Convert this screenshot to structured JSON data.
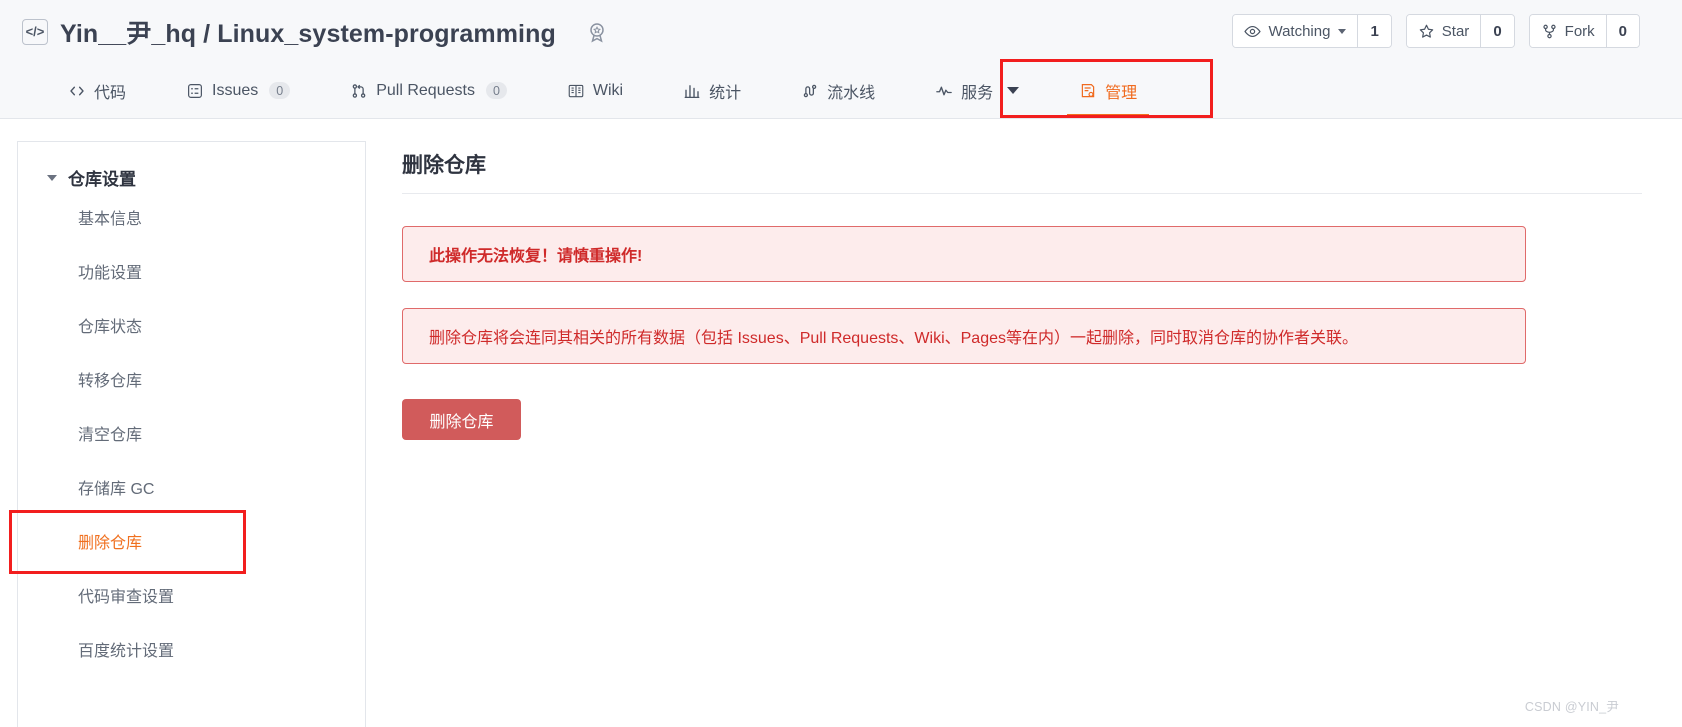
{
  "header": {
    "repo_icon": "code-brackets-icon",
    "owner": "Yin__尹_hq",
    "separator": "/",
    "repo_name": "Linux_system-programming",
    "badge_icon": "award-badge-icon",
    "actions": [
      {
        "icon": "eye-icon",
        "label": "Watching",
        "has_caret": true,
        "count": "1"
      },
      {
        "icon": "star-icon",
        "label": "Star",
        "has_caret": false,
        "count": "0"
      },
      {
        "icon": "fork-icon",
        "label": "Fork",
        "has_caret": false,
        "count": "0"
      }
    ]
  },
  "nav": {
    "tabs": [
      {
        "icon": "code-icon",
        "label": "代码",
        "count": null,
        "active": false,
        "caret": false
      },
      {
        "icon": "issues-icon",
        "label": "Issues",
        "count": "0",
        "active": false,
        "caret": false
      },
      {
        "icon": "pr-icon",
        "label": "Pull Requests",
        "count": "0",
        "active": false,
        "caret": false
      },
      {
        "icon": "wiki-icon",
        "label": "Wiki",
        "count": null,
        "active": false,
        "caret": false
      },
      {
        "icon": "stats-icon",
        "label": "统计",
        "count": null,
        "active": false,
        "caret": false
      },
      {
        "icon": "pipeline-icon",
        "label": "流水线",
        "count": null,
        "active": false,
        "caret": false
      },
      {
        "icon": "service-icon",
        "label": "服务",
        "count": null,
        "active": false,
        "caret": true
      },
      {
        "icon": "manage-icon",
        "label": "管理",
        "count": null,
        "active": true,
        "caret": false
      }
    ]
  },
  "sidebar": {
    "group_title": "仓库设置",
    "items": [
      {
        "label": "基本信息",
        "active": false
      },
      {
        "label": "功能设置",
        "active": false
      },
      {
        "label": "仓库状态",
        "active": false
      },
      {
        "label": "转移仓库",
        "active": false
      },
      {
        "label": "清空仓库",
        "active": false
      },
      {
        "label": "存储库 GC",
        "active": false
      },
      {
        "label": "删除仓库",
        "active": true
      },
      {
        "label": "代码审查设置",
        "active": false
      },
      {
        "label": "百度统计设置",
        "active": false
      }
    ]
  },
  "main": {
    "title": "删除仓库",
    "alert_warning": "此操作无法恢复！请慎重操作!",
    "alert_info": "删除仓库将会连同其相关的所有数据（包括 Issues、Pull Requests、Wiki、Pages等在内）一起删除，同时取消仓库的协作者关联。",
    "delete_button": "删除仓库"
  },
  "watermark": "CSDN @YIN_尹",
  "colors": {
    "accent_orange": "#f0701f",
    "danger_red": "#cf2a2a",
    "alert_bg": "#fdecec",
    "alert_border": "#e06a6a",
    "button_bg": "#d15b5b",
    "annotation_red": "#f21e1e",
    "header_bg": "#f7f8fa",
    "text_primary": "#3b4252",
    "text_muted": "#636b78"
  }
}
